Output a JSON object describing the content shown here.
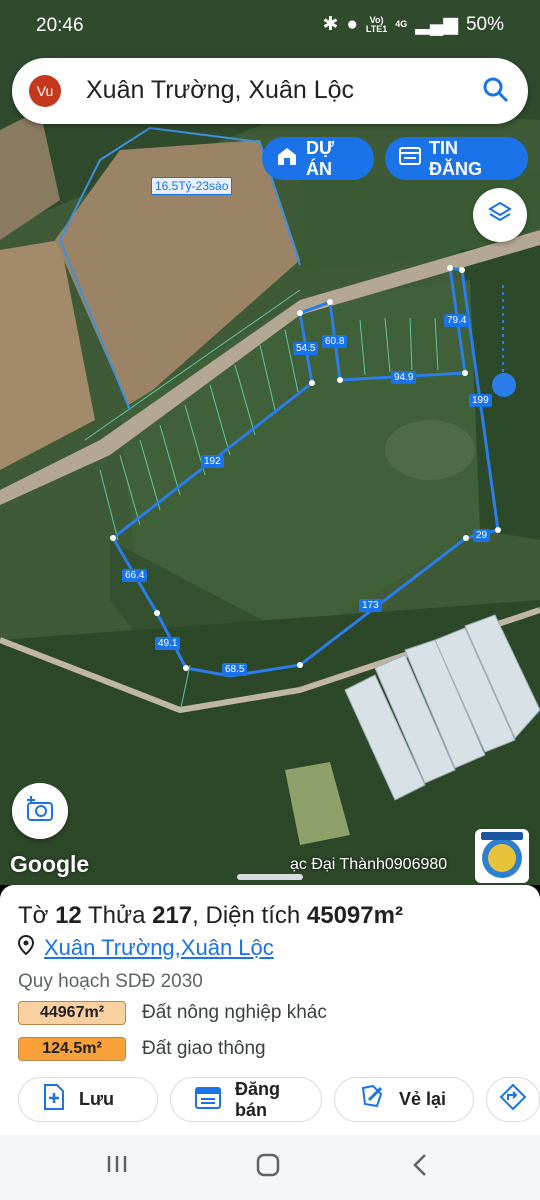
{
  "status": {
    "time": "20:46",
    "net1": "Vo)",
    "net2": "LTE1",
    "net3": "4G",
    "battery": "50%"
  },
  "search": {
    "avatar": "Vu",
    "text": "Xuân Trường, Xuân Lộc"
  },
  "buttons": {
    "du_an": "DỰ ÁN",
    "tin_dang": "TIN ĐĂNG"
  },
  "map": {
    "parcel_label": "16.5Tỷ-23sào",
    "edge_labels": [
      "79.4",
      "54.5",
      "60.8",
      "94.9",
      "199",
      "192",
      "29",
      "66.4",
      "173",
      "49.1",
      "68.5"
    ],
    "google": "Google",
    "credit": "ạc Đại Thành0906980"
  },
  "sheet": {
    "title_prefix": "Tờ ",
    "sheet_no": "12",
    "thua_label": " Thửa ",
    "thua_no": "217",
    "area_label": ", Diện tích ",
    "area_value": "45097m²",
    "commune": "Xuân Trường",
    "separator": ", ",
    "district": "Xuân Lộc",
    "plan": "Quy hoạch SDĐ 2030",
    "landuse": [
      {
        "area": "44967m²",
        "name": "Đất nông nghiệp khác",
        "color": "#f9d0a0"
      },
      {
        "area": "124.5m²",
        "name": "Đất giao thông",
        "color": "#f8a13a"
      }
    ],
    "actions": {
      "save": "Lưu",
      "sell": "Đăng bán",
      "redraw": "Vẻ lại"
    }
  }
}
